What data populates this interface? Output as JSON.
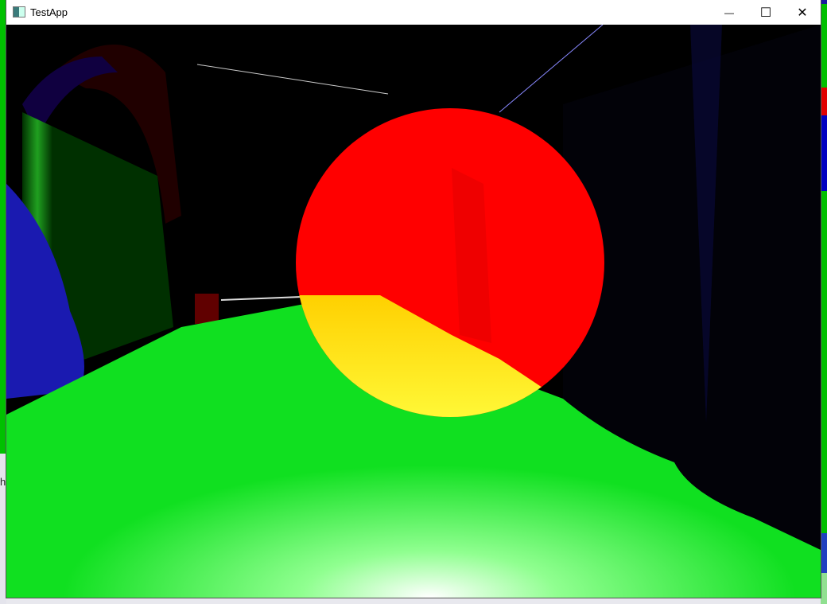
{
  "window": {
    "title": "TestApp",
    "controls": {
      "minimize": "—",
      "maximize": "☐",
      "close": "✕"
    }
  },
  "desktop": {
    "partial_text": "h"
  },
  "scene": {
    "colors": {
      "floor": "#00e020",
      "sphere": "#ff0000",
      "sphere_lit": "#ffe000",
      "curtain": "#00a000",
      "cloth": "#2020e0",
      "background": "#000000"
    }
  }
}
